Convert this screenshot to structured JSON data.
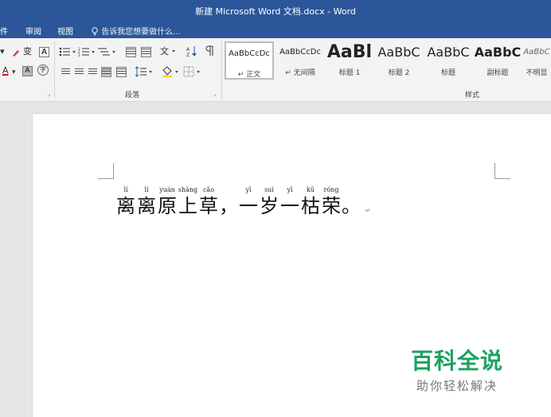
{
  "window": {
    "title": "新建 Microsoft Word 文档.docx - Word"
  },
  "menu": {
    "file": "件",
    "review": "审阅",
    "view": "视图",
    "tell_me": "告诉我您想要做什么..."
  },
  "ribbon": {
    "font_group": {
      "phonetic_icon": "变",
      "char_border": "A",
      "font_color": "A",
      "char_shade": "A",
      "enclosed": "字"
    },
    "paragraph_group": {
      "label": "段落"
    },
    "styles_group": {
      "label": "样式",
      "items": [
        {
          "sample": "AaBbCcDc",
          "name": "↵ 正文"
        },
        {
          "sample": "AaBbCcDc",
          "name": "↵ 无间隔"
        },
        {
          "sample": "AaBl",
          "name": "标题 1"
        },
        {
          "sample": "AaBbC",
          "name": "标题 2"
        },
        {
          "sample": "AaBbC",
          "name": "标题"
        },
        {
          "sample": "AaBbC",
          "name": "副标题"
        },
        {
          "sample": "AaBbC",
          "name": "不明显"
        }
      ]
    }
  },
  "document": {
    "poem": [
      {
        "py": "lí",
        "hz": "离"
      },
      {
        "py": "lí",
        "hz": "离"
      },
      {
        "py": "yuán",
        "hz": "原"
      },
      {
        "py": "shàng",
        "hz": "上"
      },
      {
        "py": "cǎo",
        "hz": "草"
      },
      {
        "py": "",
        "hz": "，"
      },
      {
        "py": "yī",
        "hz": "一"
      },
      {
        "py": "suì",
        "hz": "岁"
      },
      {
        "py": "yī",
        "hz": "一"
      },
      {
        "py": "kū",
        "hz": "枯"
      },
      {
        "py": "róng",
        "hz": "荣"
      },
      {
        "py": "",
        "hz": "。"
      }
    ],
    "paragraph_mark": "↵"
  },
  "watermark": {
    "title": "百科全说",
    "subtitle": "助你轻松解决"
  },
  "colors": {
    "brand_blue": "#2b579a",
    "watermark_green": "#1aa260"
  }
}
